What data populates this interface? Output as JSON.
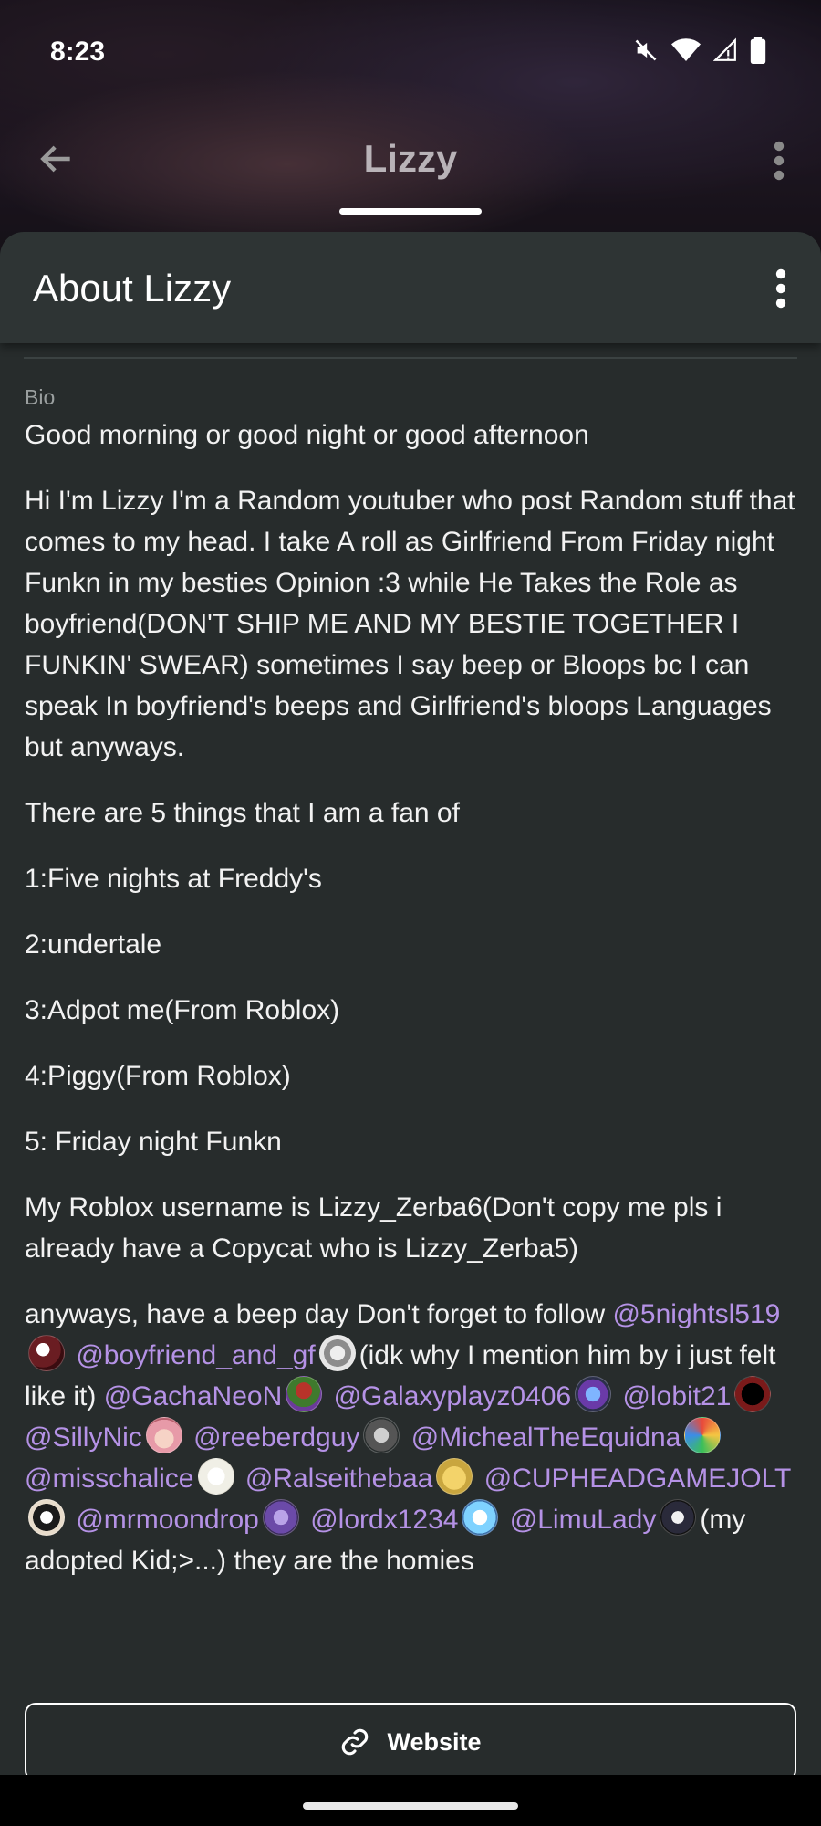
{
  "status_bar": {
    "time": "8:23"
  },
  "nav": {
    "title": "Lizzy"
  },
  "sheet": {
    "title": "About Lizzy"
  },
  "bio": {
    "label": "Bio",
    "greeting": "Good morning or good night or good afternoon",
    "intro": "Hi I'm Lizzy I'm a Random youtuber who post Random stuff that comes to my head. I take A roll as Girlfriend From Friday night Funkn in my besties Opinion :3 while He Takes the Role as boyfriend(DON'T SHIP ME AND MY BESTIE TOGETHER I FUNKIN' SWEAR) sometimes I say beep or Bloops bc I can speak In boyfriend's beeps and Girlfriend's bloops Languages but anyways.",
    "fans_intro": "There are 5 things that I am a fan of",
    "fans": [
      "1:Five nights at Freddy's",
      "2:undertale",
      "3:Adpot me(From Roblox)",
      "4:Piggy(From Roblox)",
      "5: Friday night Funkn"
    ],
    "roblox": "My Roblox username is Lizzy_Zerba6(Don't copy me pls i already have a Copycat who is Lizzy_Zerba5)",
    "follow_intro": "anyways, have a beep day Don't forget to follow",
    "mentions": [
      "@5nightsl519",
      "@boyfriend_and_gf",
      "@GachaNeoN",
      "@Galaxyplayz0406",
      "@lobit21",
      "@SillyNic",
      "@reeberdguy",
      "@MichealTheEquidna",
      "@misschalice",
      "@Ralseithebaa",
      "@CUPHEADGAMEJOLT",
      "@mrmoondrop",
      "@lordx1234",
      "@LimuLady"
    ],
    "note_bf": "(idk why I mention him by i just felt like it)",
    "note_limu": "(my adopted Kid;>...)",
    "closing": "they are the homies"
  },
  "website_button": {
    "label": "Website"
  },
  "colors": {
    "sheet_bg": "#272c2c",
    "mention": "#b592e6",
    "header_bg": "#2e3434"
  },
  "icons": [
    "back-arrow-icon",
    "more-vert-icon",
    "mute-icon",
    "wifi-icon",
    "signal-icon",
    "battery-icon",
    "link-icon"
  ]
}
